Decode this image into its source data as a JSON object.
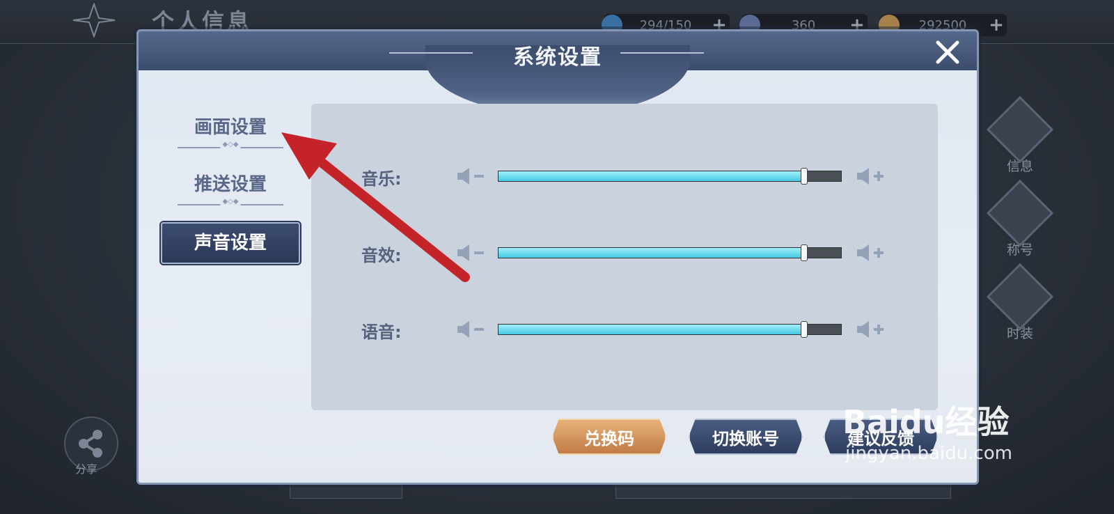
{
  "background": {
    "page_title": "个人信息",
    "resources": [
      {
        "icon": "energy-icon",
        "value": "294/150",
        "plus": "+"
      },
      {
        "icon": "crystal-icon",
        "value": "360",
        "plus": "+"
      },
      {
        "icon": "coin-icon",
        "value": "292500",
        "plus": "+"
      }
    ],
    "side_buttons": [
      {
        "icon": "book-icon",
        "label": "信息"
      },
      {
        "icon": "emblem-icon",
        "label": "称号"
      },
      {
        "icon": "outfit-icon",
        "label": "时装"
      }
    ],
    "share_label": "分享"
  },
  "dialog": {
    "title": "系统设置",
    "close_icon": "close-icon",
    "tabs": [
      {
        "label": "画面设置",
        "active": false
      },
      {
        "label": "推送设置",
        "active": false
      },
      {
        "label": "声音设置",
        "active": true
      }
    ],
    "sound": [
      {
        "label": "音乐:",
        "level": 0.89
      },
      {
        "label": "音效:",
        "level": 0.89
      },
      {
        "label": "语音:",
        "level": 0.89
      }
    ],
    "buttons": {
      "redeem": "兑换码",
      "switch_account": "切换账号",
      "feedback": "建议反馈"
    }
  },
  "colors": {
    "accent_cyan": "#46c9e2",
    "header_navy": "#3c4c6d",
    "annotation_red": "#c4232a"
  },
  "watermark": {
    "brand": "Baidu经验",
    "url": "jingyan.baidu.com"
  }
}
